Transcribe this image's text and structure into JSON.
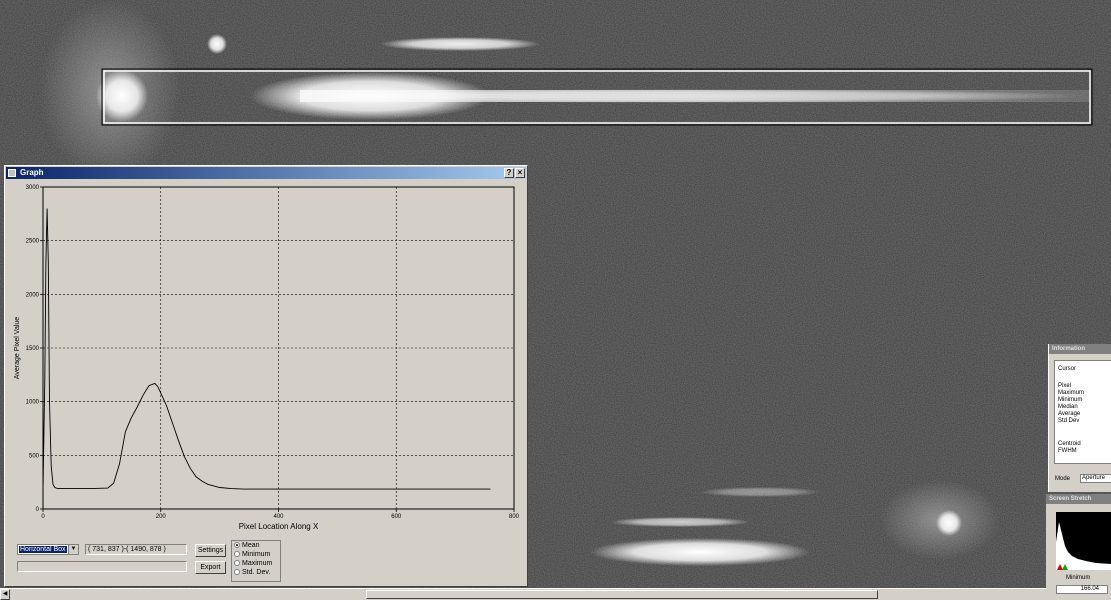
{
  "graph": {
    "title": "Graph",
    "help_label": "?",
    "close_label": "×",
    "mode_value": "Horizontal Box",
    "coords": "( 731, 837 )-( 1490, 878 )",
    "settings_label": "Settings",
    "export_label": "Export",
    "radio_options": [
      "Mean",
      "Minimum",
      "Maximum",
      "Std. Dev."
    ],
    "radio_selected": "Mean"
  },
  "chart_data": {
    "type": "line",
    "title": "",
    "xlabel": "Pixel Location Along X",
    "ylabel": "Average Pixel Value",
    "xlim": [
      0,
      800
    ],
    "ylim": [
      0,
      3000
    ],
    "xticks": [
      0,
      200,
      400,
      600,
      800
    ],
    "yticks": [
      0,
      500,
      1000,
      1500,
      2000,
      2500,
      3000
    ],
    "grid": true,
    "series": [
      {
        "x": [
          0,
          3,
          5,
          7,
          9,
          11,
          14,
          17,
          20,
          25,
          40,
          80,
          110,
          120,
          130,
          140,
          150,
          160,
          170,
          180,
          190,
          195,
          200,
          210,
          220,
          230,
          240,
          250,
          260,
          270,
          280,
          300,
          320,
          340,
          400,
          500,
          600,
          700,
          760
        ],
        "y": [
          180,
          1200,
          2300,
          2800,
          2300,
          1000,
          400,
          230,
          200,
          190,
          190,
          190,
          195,
          240,
          420,
          720,
          850,
          950,
          1060,
          1150,
          1170,
          1140,
          1080,
          960,
          800,
          640,
          490,
          380,
          300,
          260,
          230,
          200,
          190,
          185,
          185,
          185,
          185,
          185,
          185
        ]
      }
    ]
  },
  "information": {
    "title": "Information",
    "labels": [
      "Cursor",
      "Pixel",
      "Maximum",
      "Minimum",
      "Median",
      "Average",
      "Std Dev",
      "Centroid",
      "FWHM"
    ],
    "mode_label": "Mode",
    "mode_value": "Aperture"
  },
  "screen_stretch": {
    "title": "Screen Stretch",
    "minimum_label": "Minimum",
    "minimum_value": "166.04"
  }
}
